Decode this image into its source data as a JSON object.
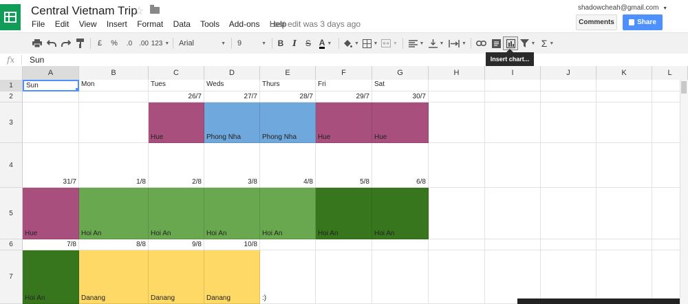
{
  "app": {
    "title": "Central Vietnam Trip",
    "star_icon": "star-outline-icon",
    "folder_icon": "folder-icon",
    "last_edit": "Last edit was 3 days ago",
    "account": "shadowcheah@gmail.com",
    "comments_label": "Comments",
    "share_label": "Share"
  },
  "menu": [
    "File",
    "Edit",
    "View",
    "Insert",
    "Format",
    "Data",
    "Tools",
    "Add-ons",
    "Help"
  ],
  "toolbar": {
    "currency": "£",
    "percent": "%",
    "dec_less": ".0",
    "dec_more": ".00",
    "more_formats": "123",
    "font": "Arial",
    "size": "9",
    "bold": "B",
    "italic": "I",
    "strike": "S",
    "text_color": "A",
    "function": "Σ",
    "tooltip": "Insert chart..."
  },
  "formula": {
    "fx": "fx",
    "value": "Sun"
  },
  "columns": [
    "A",
    "B",
    "C",
    "D",
    "E",
    "F",
    "G",
    "H",
    "I",
    "J",
    "K",
    "L"
  ],
  "rows": [
    "1",
    "2",
    "3",
    "4",
    "5",
    "6",
    "7"
  ],
  "colors": {
    "purple": "#a94f7e",
    "blue": "#6fa8dc",
    "light_green": "#6aa84f",
    "dark_green": "#38761d",
    "yellow": "#ffd966"
  },
  "cells": {
    "A1": "Sun",
    "B1": "Mon",
    "C1": "Tues",
    "D1": "Weds",
    "E1": "Thurs",
    "F1": "Fri",
    "G1": "Sat",
    "C2": "26/7",
    "D2": "27/7",
    "E2": "28/7",
    "F2": "29/7",
    "G2": "30/7",
    "C3": "Hue",
    "D3": "Phong Nha",
    "E3": "Phong Nha",
    "F3": "Hue",
    "G3": "Hue",
    "A4": "31/7",
    "B4": "1/8",
    "C4": "2/8",
    "D4": "3/8",
    "E4": "4/8",
    "F4": "5/8",
    "G4": "6/8",
    "A5": "Hue",
    "B5": "Hoi An",
    "C5": "Hoi An",
    "D5": "Hoi An",
    "E5": "Hoi An",
    "F5": "Hoi An",
    "G5": "Hoi An",
    "A6": "7/8",
    "B6": "8/8",
    "C6": "9/8",
    "D6": "10/8",
    "A7": "Hoi An",
    "B7": "Danang",
    "C7": "Danang",
    "D7": "Danang",
    "E7": ":)"
  }
}
